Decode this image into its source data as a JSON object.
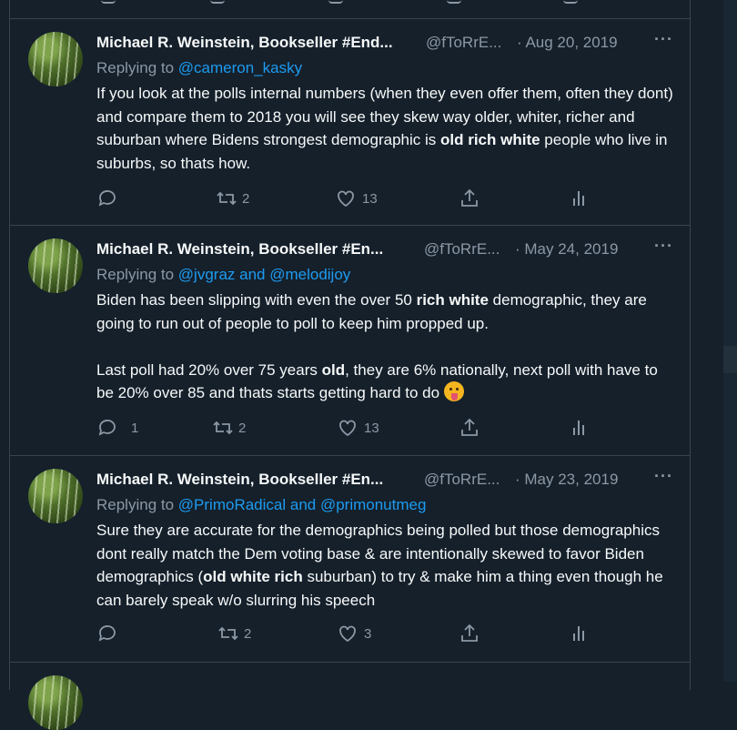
{
  "tweets": [
    {
      "name": "Michael R. Weinstein, Bookseller #End...",
      "handle": "@fToRrE...",
      "date": "· Aug 20, 2019",
      "more": "···",
      "replying_prefix": "Replying to",
      "replying_to": "@cameron_kasky",
      "body": {
        "p1": "If you look at the polls internal numbers (when they even offer them, often they dont) and compare them to 2018 you will see they skew way older, whiter, richer and suburban where Bidens strongest demographic is ",
        "b1": "old rich white",
        "p2": " people who live in suburbs, so thats how."
      },
      "counts": {
        "reply": "",
        "retweet": "2",
        "like": "13"
      }
    },
    {
      "name": "Michael R. Weinstein, Bookseller #En...",
      "handle": "@fToRrE...",
      "date": "· May 24, 2019",
      "more": "···",
      "replying_prefix": "Replying to",
      "replying_to": "@jvgraz and @melodijoy",
      "body": {
        "p1": "Biden has been slipping with even the over 50 ",
        "b1": "rich white",
        "p2": " demographic, they are going to run out of people to poll to keep him propped up.",
        "p3": "Last poll had 20% over 75 years ",
        "b2": "old",
        "p4": ", they are 6% nationally, next poll with have to be 20% over 85 and thats starts getting hard to do "
      },
      "counts": {
        "reply": "1",
        "retweet": "2",
        "like": "13"
      }
    },
    {
      "name": "Michael R. Weinstein, Bookseller #En...",
      "handle": "@fToRrE...",
      "date": "· May 23, 2019",
      "more": "···",
      "replying_prefix": "Replying to",
      "replying_to": "@PrimoRadical and @primonutmeg",
      "body": {
        "p1": "Sure they are accurate for the demographics being polled but those demographics dont really match the Dem voting base & are intentionally skewed to favor Biden demographics (",
        "b1": "old white rich",
        "p2": " suburban) to try & make him a thing even though he can barely speak w/o slurring his speech"
      },
      "counts": {
        "reply": "",
        "retweet": "2",
        "like": "3"
      }
    }
  ],
  "colors": {
    "background": "#15202b",
    "text": "#f7f9f9",
    "muted": "#8b98a5",
    "link": "#1d9bf0",
    "border": "#38444d"
  },
  "icons": [
    "reply-icon",
    "retweet-icon",
    "like-icon",
    "share-icon",
    "analytics-icon",
    "more-icon",
    "tongue-emoji-icon"
  ]
}
